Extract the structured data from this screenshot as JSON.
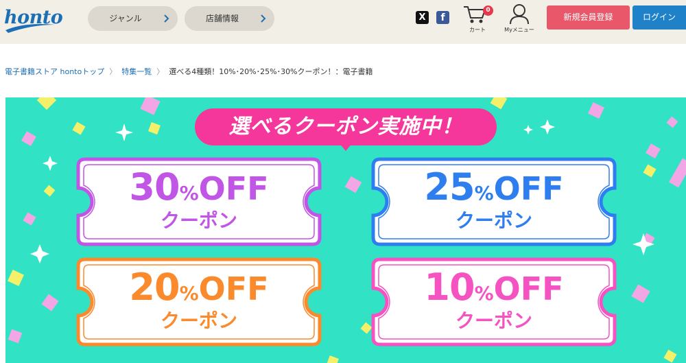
{
  "header": {
    "logo": "honto",
    "nav": [
      {
        "label": "ジャンル"
      },
      {
        "label": "店舗情報"
      }
    ],
    "social": {
      "x": "X",
      "facebook": "f"
    },
    "cart": {
      "label": "カート",
      "count": "0"
    },
    "mymenu": {
      "label": "Myメニュー"
    },
    "register_label": "新規会員登録",
    "login_label": "ログイン"
  },
  "breadcrumb": {
    "items": [
      "電子書籍ストア hontoトップ",
      "特集一覧"
    ],
    "current": "選べる4種類！10%･20%･25%･30%クーポン！：電子書籍"
  },
  "banner": {
    "headline": "選べるクーポン実施中！",
    "coupons": [
      {
        "num": "30",
        "pct": "%",
        "off": "OFF",
        "sub": "クーポン",
        "color": "#c155e6"
      },
      {
        "num": "25",
        "pct": "%",
        "off": "OFF",
        "sub": "クーポン",
        "color": "#2e7ef0"
      },
      {
        "num": "20",
        "pct": "%",
        "off": "OFF",
        "sub": "クーポン",
        "color": "#fb8a2c"
      },
      {
        "num": "10",
        "pct": "%",
        "off": "OFF",
        "sub": "クーポン",
        "color": "#f552c2"
      }
    ]
  },
  "colors": {
    "header_bg": "#f2efe6",
    "register": "#e8576a",
    "login": "#1f82c8",
    "banner_bg": "#31e3c4",
    "headline_bg": "#f5369a"
  }
}
